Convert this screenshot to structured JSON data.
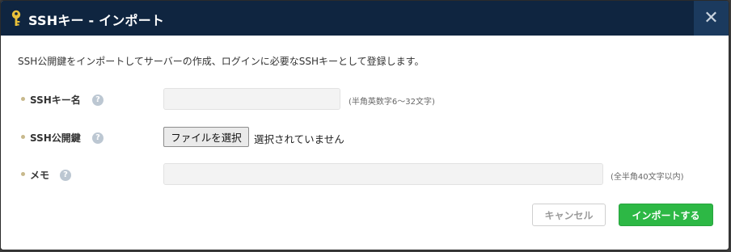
{
  "dialog": {
    "title": "SSHキー - インポート",
    "title_icon": "key-icon",
    "close_icon": "close-icon",
    "close_glyph": "✕",
    "description": "SSH公開鍵をインポートしてサーバーの作成、ログインに必要なSSHキーとして登録します。"
  },
  "form": {
    "name": {
      "label": "SSHキー名",
      "help_glyph": "?",
      "value": "",
      "placeholder": "",
      "hint": "(半角英数字6～32文字)"
    },
    "public_key": {
      "label": "SSH公開鍵",
      "help_glyph": "?",
      "file_button": "ファイルを選択",
      "file_status": "選択されていません"
    },
    "memo": {
      "label": "メモ",
      "help_glyph": "?",
      "value": "",
      "placeholder": "",
      "hint": "(全半角40文字以内)"
    }
  },
  "footer": {
    "cancel_label": "キャンセル",
    "import_label": "インポートする"
  },
  "colors": {
    "titlebar": "#0f2540",
    "close_bg": "#1b3a5e",
    "primary_button": "#2db845",
    "key_icon": "#e9c13a"
  }
}
